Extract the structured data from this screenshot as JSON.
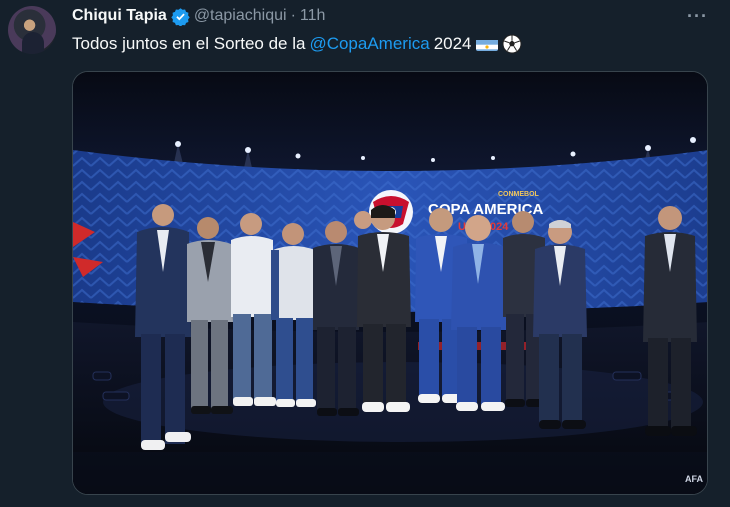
{
  "tweet": {
    "author_name": "Chiqui Tapia",
    "handle": "@tapiachiqui",
    "separator": "·",
    "time": "11h",
    "more_label": "···",
    "text_before": "Todos juntos en el Sorteo de la",
    "mention": "@CopaAmerica",
    "text_after": "2024",
    "flag_icon": "argentina-flag-icon",
    "ball_icon": "soccer-ball-icon"
  },
  "media": {
    "screen_small_label": "CONMEBOL",
    "screen_title": "COPA AMERICA",
    "screen_sub": "USA 2024",
    "watermark": "AFA"
  },
  "colors": {
    "background": "#15202b",
    "link": "#1d9bf0",
    "muted": "#8b98a5",
    "verified": "#1d9bf0"
  }
}
